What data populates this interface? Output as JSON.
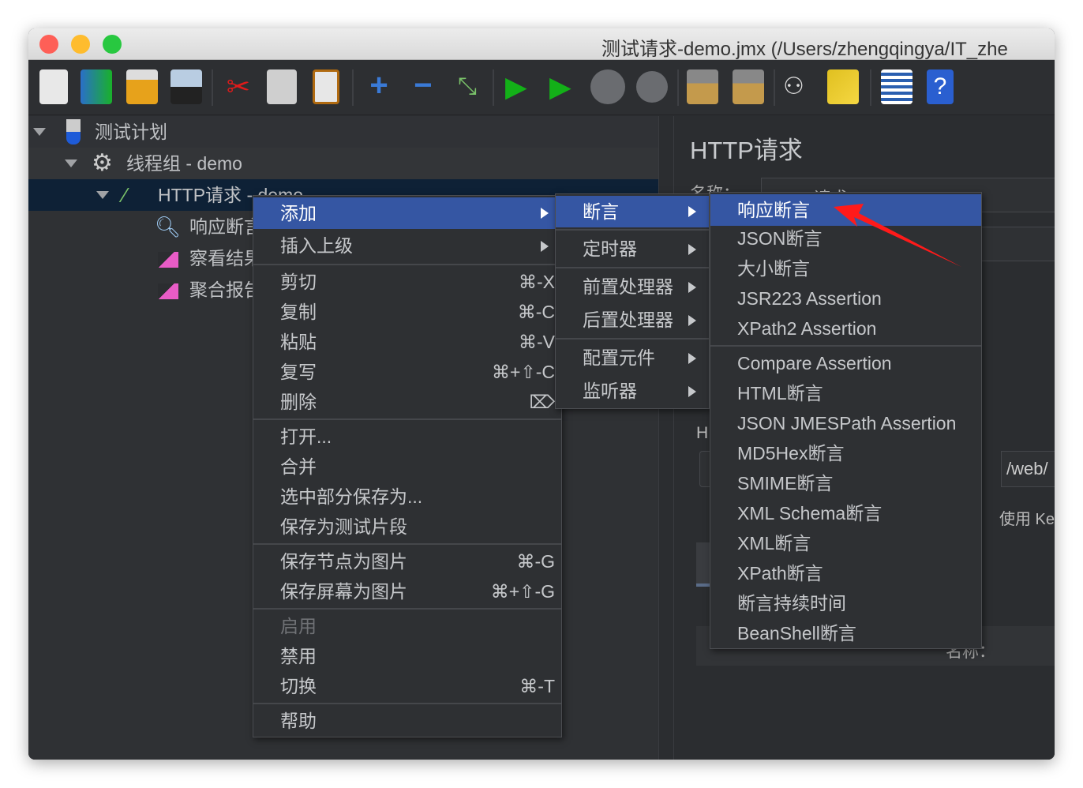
{
  "window": {
    "title": "测试请求-demo.jmx (/Users/zhengqingya/IT_zhe"
  },
  "toolbar": {
    "icons": [
      "new-icon",
      "templates-icon",
      "open-icon",
      "save-icon",
      "cut-icon",
      "copy-icon",
      "paste-icon",
      "expand-icon",
      "collapse-icon",
      "toggle-icon",
      "start-icon",
      "start-no-pause-icon",
      "stop-icon",
      "shutdown-icon",
      "clear-icon",
      "clear-all-icon",
      "search-icon",
      "reset-search-icon",
      "function-helper-icon",
      "help-icon"
    ]
  },
  "tree": {
    "items": [
      {
        "label": "测试计划"
      },
      {
        "label": "线程组 - demo"
      },
      {
        "label": "HTTP请求 - demo"
      },
      {
        "label": "响应断言"
      },
      {
        "label": "察看结果树"
      },
      {
        "label": "聚合报告"
      }
    ]
  },
  "panel": {
    "title": "HTTP请求",
    "name_label": "名称：",
    "name_value": "HTTP请求 - demo",
    "section_label": "H",
    "path_value": "/web/",
    "keepalive_label": "使用 KeepAlive",
    "name2_label": "名称："
  },
  "menu1": {
    "items": [
      {
        "label": "添加",
        "submenu": true,
        "highlighted": true
      },
      {
        "label": "插入上级",
        "submenu": true
      },
      {
        "label": "剪切",
        "shortcut": "⌘-X"
      },
      {
        "label": "复制",
        "shortcut": "⌘-C"
      },
      {
        "label": "粘贴",
        "shortcut": "⌘-V"
      },
      {
        "label": "复写",
        "shortcut": "⌘+⇧-C"
      },
      {
        "label": "删除",
        "shortcut": "⌦"
      },
      {
        "label": "打开..."
      },
      {
        "label": "合并"
      },
      {
        "label": "选中部分保存为..."
      },
      {
        "label": "保存为测试片段"
      },
      {
        "label": "保存节点为图片",
        "shortcut": "⌘-G"
      },
      {
        "label": "保存屏幕为图片",
        "shortcut": "⌘+⇧-G"
      },
      {
        "label": "启用",
        "disabled": true
      },
      {
        "label": "禁用"
      },
      {
        "label": "切换",
        "shortcut": "⌘-T"
      },
      {
        "label": "帮助"
      }
    ]
  },
  "menu2": {
    "items": [
      {
        "label": "断言",
        "highlighted": true
      },
      {
        "label": "定时器"
      },
      {
        "label": "前置处理器"
      },
      {
        "label": "后置处理器"
      },
      {
        "label": "配置元件"
      },
      {
        "label": "监听器"
      }
    ]
  },
  "menu3": {
    "items": [
      {
        "label": "响应断言",
        "highlighted": true
      },
      {
        "label": "JSON断言"
      },
      {
        "label": "大小断言"
      },
      {
        "label": "JSR223 Assertion"
      },
      {
        "label": "XPath2 Assertion"
      },
      {
        "label": "Compare Assertion"
      },
      {
        "label": "HTML断言"
      },
      {
        "label": "JSON JMESPath Assertion"
      },
      {
        "label": "MD5Hex断言"
      },
      {
        "label": "SMIME断言"
      },
      {
        "label": "XML Schema断言"
      },
      {
        "label": "XML断言"
      },
      {
        "label": "XPath断言"
      },
      {
        "label": "断言持续时间"
      },
      {
        "label": "BeanShell断言"
      }
    ]
  },
  "annotation": {
    "arrow_color": "#ff1a1a"
  }
}
